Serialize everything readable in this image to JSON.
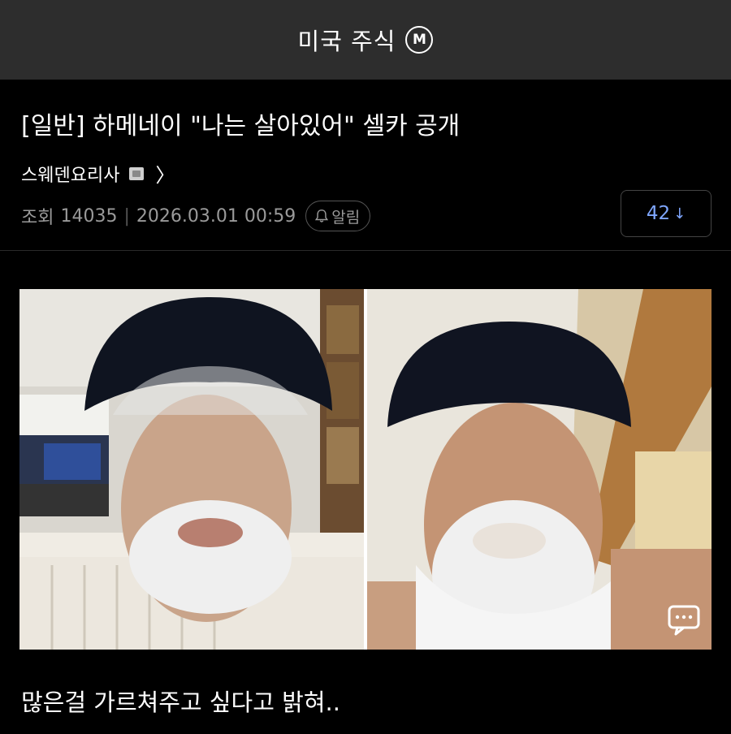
{
  "header": {
    "title": "미국 주식",
    "badge": "M"
  },
  "post": {
    "title": "[일반] 하메네이 \"나는 살아있어\" 셀카 공개",
    "author": "스웨덴요리사",
    "views_label": "조회",
    "views": "14035",
    "datetime": "2026.03.01 00:59",
    "alarm_label": "알림",
    "comments": "42",
    "comments_arrow": "↓",
    "caption": "많은걸 가르쳐주고 싶다고 밝혀.."
  },
  "icons": {
    "m_badge": "m-badge-icon",
    "author_badge": "image-badge-icon",
    "chevron": "chevron-right-icon",
    "alarm": "bell-icon",
    "chat": "chat-bubble-icon"
  },
  "colors": {
    "accent": "#7fa7ff",
    "topbar": "#2d2d2d",
    "background": "#000000"
  }
}
